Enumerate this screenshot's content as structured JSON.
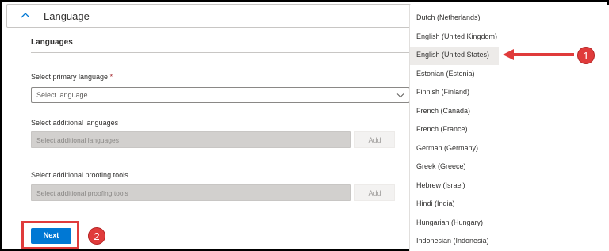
{
  "section": {
    "title": "Language",
    "expanded": true
  },
  "languages": {
    "heading": "Languages"
  },
  "primary": {
    "label": "Select primary language",
    "required_mark": "*",
    "placeholder": "Select language"
  },
  "additional_languages": {
    "label": "Select additional languages",
    "placeholder": "Select additional languages",
    "add_label": "Add"
  },
  "proofing": {
    "label": "Select additional proofing tools",
    "placeholder": "Select additional proofing tools",
    "add_label": "Add"
  },
  "next_label": "Next",
  "dropdown_options": [
    {
      "label": "Dutch (Netherlands)"
    },
    {
      "label": "English (United Kingdom)"
    },
    {
      "label": "English (United States)",
      "selected": true
    },
    {
      "label": "Estonian (Estonia)"
    },
    {
      "label": "Finnish (Finland)"
    },
    {
      "label": "French (Canada)"
    },
    {
      "label": "French (France)"
    },
    {
      "label": "German (Germany)"
    },
    {
      "label": "Greek (Greece)"
    },
    {
      "label": "Hebrew (Israel)"
    },
    {
      "label": "Hindi (India)"
    },
    {
      "label": "Hungarian (Hungary)"
    },
    {
      "label": "Indonesian (Indonesia)"
    }
  ],
  "annotations": {
    "step1": "1",
    "step2": "2"
  },
  "colors": {
    "accent": "#0078d4",
    "annotation_red": "#e03b3b",
    "selected_bg": "#edebe9"
  }
}
